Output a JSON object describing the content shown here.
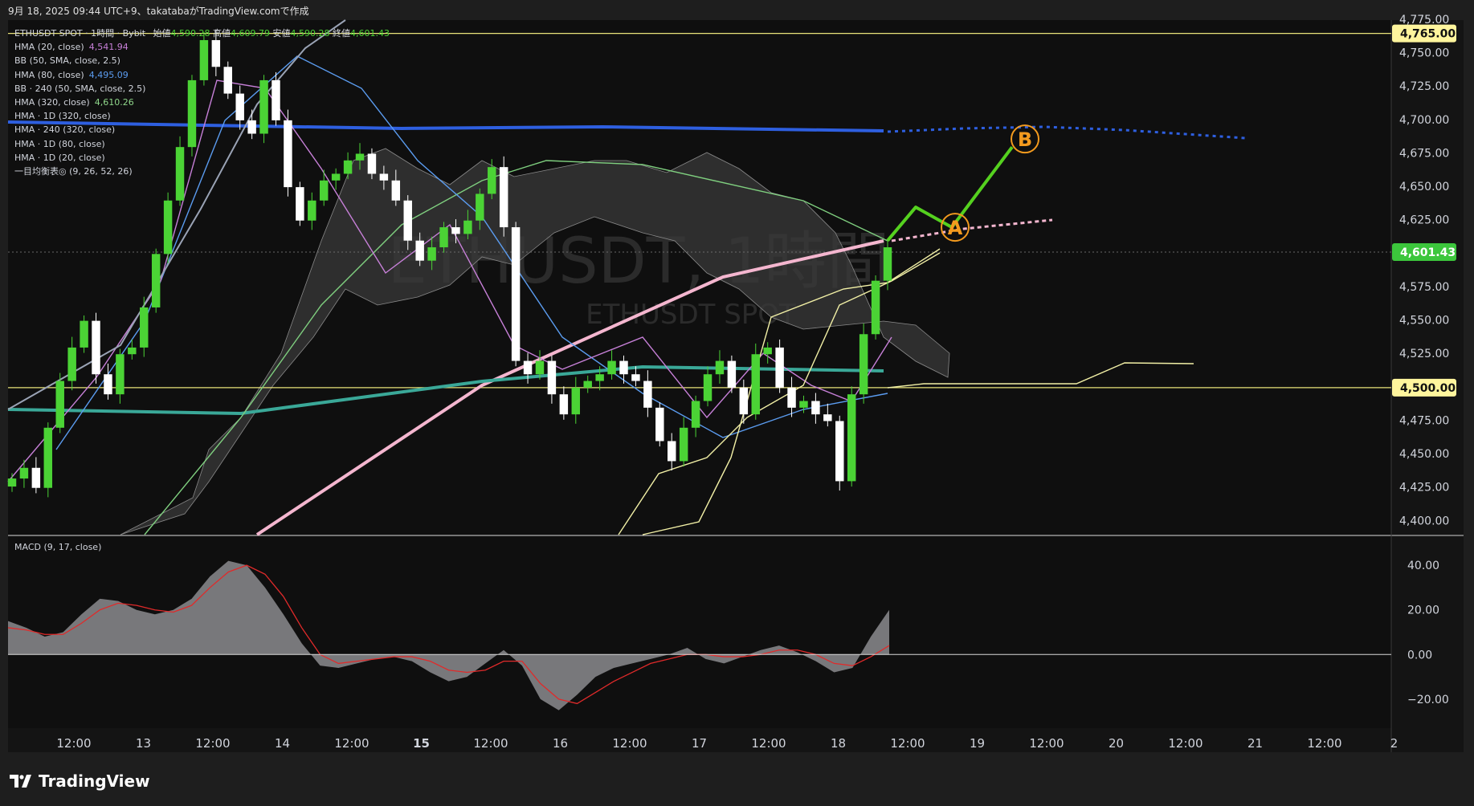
{
  "caption": "9月 18, 2025 09:44 UTC+9、takatabaがTradingView.comで作成",
  "brand": "TradingView",
  "header": {
    "symbol": "ETHUSDT SPOT · 1時間 · Bybit",
    "open_label": "始値",
    "open": "4,590.28",
    "high_label": "高値",
    "high": "4,609.79",
    "low_label": "安値",
    "low": "4,590.28",
    "close_label": "終値",
    "close": "4,601.43"
  },
  "indicators": [
    {
      "label": "HMA (20, close)",
      "value": "4,541.94",
      "color": "#c780d8"
    },
    {
      "label": "BB (50, SMA, close, 2.5)",
      "value": "",
      "color": "#d1d4dc"
    },
    {
      "label": "HMA (80, close)",
      "value": "4,495.09",
      "color": "#5b9cf0"
    },
    {
      "label": "BB · 240 (50, SMA, close, 2.5)",
      "value": "",
      "color": "#d1d4dc"
    },
    {
      "label": "HMA (320, close)",
      "value": "4,610.26",
      "color": "#8fd68a"
    },
    {
      "label": "HMA · 1D (320, close)",
      "value": "",
      "color": "#d1d4dc"
    },
    {
      "label": "HMA · 240 (320, close)",
      "value": "",
      "color": "#d1d4dc"
    },
    {
      "label": "HMA · 1D (80, close)",
      "value": "",
      "color": "#d1d4dc"
    },
    {
      "label": "HMA · 1D (20, close)",
      "value": "",
      "color": "#d1d4dc"
    },
    {
      "label": "一目均衡表◎ (9, 26, 52, 26)",
      "value": "",
      "color": "#d1d4dc"
    }
  ],
  "watermark": {
    "big": "ETHUSDT, 1時間",
    "small": "ETHUSDT SPOT"
  },
  "colors": {
    "up": "#4bd335",
    "down": "#ffffff",
    "bg": "#0f0f0f",
    "macd_fill": "#8b8b8e",
    "signal": "#e02a2a",
    "hline": "#e9e37a",
    "label_bg": "#fff59d",
    "last_bg": "#3cc63c",
    "projection": "#55d11f",
    "marker": "#f39a1e",
    "blue_line": "#2e5fe0",
    "pink_line": "#f4b6cf",
    "teal_line": "#3aa898"
  },
  "chart_data": {
    "type": "candlestick",
    "interval": "1時間",
    "ylim": [
      4390,
      4775
    ],
    "x_ticks": [
      "12:00",
      "13",
      "12:00",
      "14",
      "12:00",
      "15",
      "12:00",
      "16",
      "12:00",
      "17",
      "12:00",
      "18",
      "12:00",
      "19",
      "12:00",
      "20",
      "12:00",
      "21",
      "12:00",
      "2"
    ],
    "y_ticks": [
      "4,400.00",
      "4,425.00",
      "4,450.00",
      "4,475.00",
      "4,525.00",
      "4,550.00",
      "4,575.00",
      "4,625.00",
      "4,650.00",
      "4,675.00",
      "4,700.00",
      "4,725.00",
      "4,750.00",
      "4,775.00"
    ],
    "price_labels": [
      {
        "text": "4,765.00",
        "value": 4765,
        "kind": "level"
      },
      {
        "text": "4,601.43",
        "value": 4601.43,
        "kind": "last"
      },
      {
        "text": "4,500.00",
        "value": 4500,
        "kind": "level"
      }
    ],
    "horizontal_levels": [
      4765,
      4500
    ],
    "candle_path": [
      4432,
      4440,
      4425,
      4470,
      4505,
      4530,
      4550,
      4510,
      4495,
      4525,
      4530,
      4560,
      4600,
      4640,
      4680,
      4730,
      4760,
      4740,
      4720,
      4700,
      4690,
      4730,
      4700,
      4650,
      4625,
      4640,
      4655,
      4660,
      4670,
      4675,
      4660,
      4655,
      4640,
      4610,
      4595,
      4605,
      4620,
      4615,
      4625,
      4645,
      4665,
      4620,
      4520,
      4510,
      4520,
      4495,
      4480,
      4500,
      4505,
      4510,
      4520,
      4510,
      4505,
      4485,
      4460,
      4445,
      4470,
      4490,
      4510,
      4520,
      4500,
      4480,
      4525,
      4530,
      4500,
      4485,
      4490,
      4480,
      4475,
      4430,
      4495,
      4540,
      4580,
      4605
    ],
    "projection": {
      "points": [
        [
          4610,
          "last"
        ],
        [
          4635,
          "+1"
        ],
        [
          4620,
          "A"
        ],
        [
          4680,
          "B"
        ]
      ],
      "labels": [
        "A",
        "B"
      ]
    },
    "macd": {
      "label": "MACD (9, 17, close)",
      "ylim": [
        -33,
        53
      ],
      "y_ticks": [
        "40.00",
        "20.00",
        "0.00",
        "−20.00"
      ],
      "hist": [
        15,
        12,
        8,
        10,
        18,
        25,
        24,
        20,
        18,
        20,
        25,
        35,
        42,
        40,
        30,
        18,
        5,
        -5,
        -6,
        -4,
        -2,
        -1,
        -3,
        -8,
        -12,
        -10,
        -4,
        2,
        -5,
        -20,
        -25,
        -18,
        -10,
        -6,
        -4,
        -2,
        0,
        3,
        -2,
        -4,
        -1,
        2,
        4,
        1,
        -3,
        -8,
        -6,
        8,
        20
      ],
      "signal": [
        12,
        11,
        9,
        9,
        14,
        20,
        23,
        22,
        20,
        19,
        22,
        30,
        37,
        40,
        36,
        26,
        12,
        0,
        -4,
        -3,
        -2,
        -1,
        -1,
        -3,
        -7,
        -8,
        -7,
        -3,
        -3,
        -13,
        -20,
        -22,
        -17,
        -12,
        -8,
        -4,
        -2,
        0,
        0,
        -1,
        -1,
        0,
        2,
        2,
        0,
        -4,
        -5,
        -1,
        4
      ]
    }
  }
}
